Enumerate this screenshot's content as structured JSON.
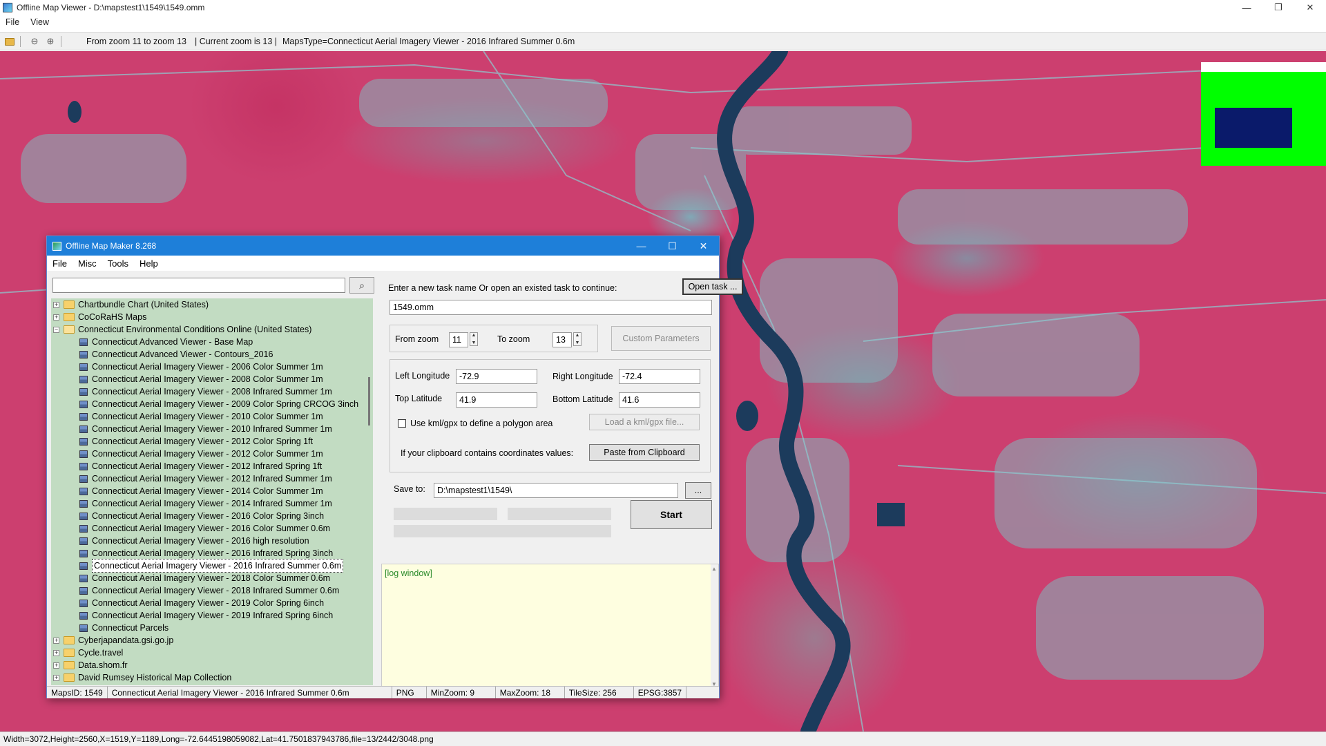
{
  "window": {
    "title": "Offline Map Viewer - D:\\mapstest1\\1549\\1549.omm",
    "controls": [
      "—",
      "❐",
      "✕"
    ]
  },
  "menu": [
    "File",
    "View"
  ],
  "toolbar": {
    "zoom_range": "From zoom 11 to zoom 13",
    "current_zoom": "|   Current zoom is 13  |",
    "maps_type": "MapsType=Connecticut Aerial Imagery Viewer - 2016 Infrared Summer 0.6m"
  },
  "map": {
    "colors": {
      "vegetation": "#cc3f6f",
      "river": "#1c3b5c",
      "urban": "#7fb8be",
      "overview_bg": "#00ff00",
      "overview_view": "#0a1a6a"
    }
  },
  "status_bar": "Width=3072,Height=2560,X=1519,Y=1189,Long=-72.6445198059082,Lat=41.7501837943786,file=13/2442/3048.png",
  "dialog": {
    "title": "Offline Map Maker 8.268",
    "controls": [
      "—",
      "☐",
      "✕"
    ],
    "menu": [
      "File",
      "Misc",
      "Tools",
      "Help"
    ],
    "search": {
      "value": "",
      "button_icon": "search-icon"
    },
    "tree": [
      {
        "label": "Chartbundle Chart (United States)",
        "type": "folder",
        "expanded": false
      },
      {
        "label": "CoCoRaHS Maps",
        "type": "folder",
        "expanded": false
      },
      {
        "label": "Connecticut Environmental Conditions Online (United States)",
        "type": "folder",
        "expanded": true
      },
      {
        "label": "Connecticut Advanced Viewer - Base Map",
        "type": "map"
      },
      {
        "label": "Connecticut Advanced Viewer - Contours_2016",
        "type": "map"
      },
      {
        "label": "Connecticut Aerial Imagery Viewer - 2006 Color Summer 1m",
        "type": "map"
      },
      {
        "label": "Connecticut Aerial Imagery Viewer - 2008 Color Summer 1m",
        "type": "map"
      },
      {
        "label": "Connecticut Aerial Imagery Viewer - 2008 Infrared Summer 1m",
        "type": "map"
      },
      {
        "label": "Connecticut Aerial Imagery Viewer - 2009 Color Spring CRCOG 3inch",
        "type": "map"
      },
      {
        "label": "Connecticut Aerial Imagery Viewer - 2010 Color Summer 1m",
        "type": "map"
      },
      {
        "label": "Connecticut Aerial Imagery Viewer - 2010 Infrared Summer 1m",
        "type": "map"
      },
      {
        "label": "Connecticut Aerial Imagery Viewer - 2012 Color Spring 1ft",
        "type": "map"
      },
      {
        "label": "Connecticut Aerial Imagery Viewer - 2012 Color Summer 1m",
        "type": "map"
      },
      {
        "label": "Connecticut Aerial Imagery Viewer - 2012 Infrared Spring 1ft",
        "type": "map"
      },
      {
        "label": "Connecticut Aerial Imagery Viewer - 2012 Infrared Summer 1m",
        "type": "map"
      },
      {
        "label": "Connecticut Aerial Imagery Viewer - 2014 Color Summer 1m",
        "type": "map"
      },
      {
        "label": "Connecticut Aerial Imagery Viewer - 2014 Infrared Summer 1m",
        "type": "map"
      },
      {
        "label": "Connecticut Aerial Imagery Viewer - 2016 Color Spring 3inch",
        "type": "map"
      },
      {
        "label": "Connecticut Aerial Imagery Viewer - 2016 Color Summer 0.6m",
        "type": "map"
      },
      {
        "label": "Connecticut Aerial Imagery Viewer - 2016 high resolution",
        "type": "map"
      },
      {
        "label": "Connecticut Aerial Imagery Viewer - 2016 Infrared Spring 3inch",
        "type": "map"
      },
      {
        "label": "Connecticut Aerial Imagery Viewer - 2016 Infrared Summer 0.6m",
        "type": "map",
        "selected": true
      },
      {
        "label": "Connecticut Aerial Imagery Viewer - 2018 Color Summer 0.6m",
        "type": "map"
      },
      {
        "label": "Connecticut Aerial Imagery Viewer - 2018 Infrared Summer 0.6m",
        "type": "map"
      },
      {
        "label": "Connecticut Aerial Imagery Viewer - 2019 Color Spring 6inch",
        "type": "map"
      },
      {
        "label": "Connecticut Aerial Imagery Viewer - 2019 Infrared Spring 6inch",
        "type": "map"
      },
      {
        "label": "Connecticut Parcels",
        "type": "map"
      },
      {
        "label": "Cyberjapandata.gsi.go.jp",
        "type": "folder",
        "expanded": false
      },
      {
        "label": "Cycle.travel",
        "type": "folder",
        "expanded": false
      },
      {
        "label": "Data.shom.fr",
        "type": "folder",
        "expanded": false
      },
      {
        "label": "David Rumsey Historical Map Collection",
        "type": "folder",
        "expanded": false
      }
    ],
    "task": {
      "prompt": "Enter a new task name Or open an existed task to continue:",
      "open_button": "Open task ...",
      "name_value": "1549.omm"
    },
    "zoom": {
      "from_label": "From zoom",
      "from_value": "11",
      "to_label": "To zoom",
      "to_value": "13",
      "custom_button": "Custom Parameters"
    },
    "area": {
      "left_lon_label": "Left Longitude",
      "left_lon_value": "-72.9",
      "right_lon_label": "Right Longitude",
      "right_lon_value": "-72.4",
      "top_lat_label": "Top Latitude",
      "top_lat_value": "41.9",
      "bottom_lat_label": "Bottom Latitude",
      "bottom_lat_value": "41.6",
      "kml_checkbox_label": "Use kml/gpx to define a polygon area",
      "kml_button": "Load a kml/gpx file...",
      "clipboard_label": "If your clipboard contains coordinates values:",
      "clipboard_button": "Paste from Clipboard"
    },
    "save": {
      "label": "Save to:",
      "path_value": "D:\\mapstest1\\1549\\",
      "browse_button": "...",
      "start_button": "Start"
    },
    "log": {
      "text": "[log window]"
    },
    "status": {
      "maps_id": "MapsID: 1549",
      "map_name": "Connecticut Aerial Imagery Viewer - 2016 Infrared Summer 0.6m",
      "format": "PNG",
      "min_zoom": "MinZoom: 9",
      "max_zoom": "MaxZoom: 18",
      "tile_size": "TileSize: 256",
      "epsg": "EPSG:3857"
    }
  }
}
